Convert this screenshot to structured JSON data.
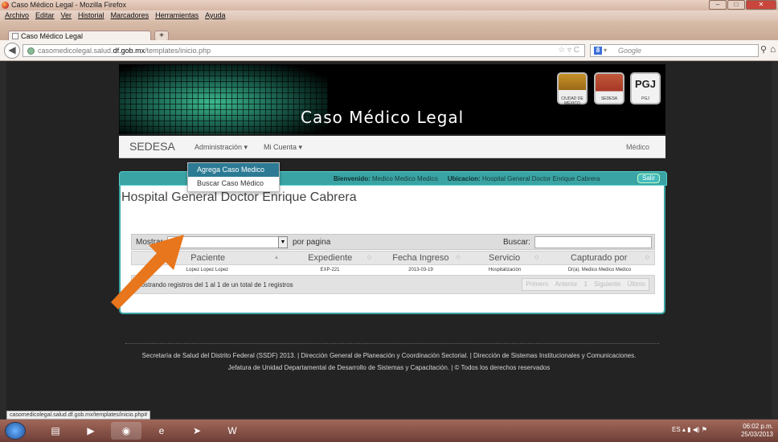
{
  "window": {
    "title": "Caso Médico Legal - Mozilla Firefox"
  },
  "menubar": [
    "Archivo",
    "Editar",
    "Ver",
    "Historial",
    "Marcadores",
    "Herramientas",
    "Ayuda"
  ],
  "tab": {
    "label": "Caso Médico Legal",
    "new_tab": "+"
  },
  "address": {
    "prefix": "casomedicolegal.salud.",
    "domain": "df.gob.mx",
    "path": "/templates/inicio.php",
    "icons": "☆ ▿ C"
  },
  "search_engine": {
    "placeholder": "Google",
    "badge": "8",
    "selector": "▾"
  },
  "banner": {
    "title": "Caso Médico Legal",
    "logos": [
      {
        "caption": "CIUDAD DE MÉXICO"
      },
      {
        "caption": "SEDESA"
      },
      {
        "text": "PGJ",
        "caption": "PGJ"
      }
    ]
  },
  "nav": {
    "brand": "SEDESA",
    "items": [
      "Administración ▾",
      "Mi Cuenta ▾"
    ],
    "right": "Médico"
  },
  "dropdown": {
    "items": [
      "Agrega Caso Medico",
      "Buscar Caso Médico"
    ],
    "active_index": 0
  },
  "welcome": {
    "bienvenido_label": "Bienvenido:",
    "bienvenido_value": "Medico Medico Medico",
    "ubicacion_label": "Ubicacion:",
    "ubicacion_value": "Hospital General Doctor Enrique Cabrera",
    "salir": "Salir"
  },
  "content": {
    "heading": "Hospital General Doctor Enrique Cabrera"
  },
  "table": {
    "mostrar_label": "Mostrar",
    "length_value": "10",
    "por_pagina": "por pagina",
    "buscar_label": "Buscar:",
    "columns": [
      "Paciente",
      "Expediente",
      "Fecha Ingreso",
      "Servicio",
      "Capturado por"
    ],
    "rows": [
      [
        "Lopez Lopez Lopez",
        "EXP-221",
        "2013-03-19",
        "Hospitalización",
        "Dr(a). Medico Medico Medico"
      ]
    ],
    "info": "Mostrando registros del 1 al 1 de un total de 1 registros",
    "pager": [
      "Primero",
      "Anterior",
      "1",
      "Siguiente",
      "Último"
    ]
  },
  "footer": {
    "line1": "Secretaría de Salud del Distrito Federal (SSDF) 2013.  |  Dirección General de Planeación y Coordinación Sectorial.  |  Dirección de Sistemas Institucionales y Comunicaciones.",
    "line2": "Jefatura de Unidad Departamental de Desarrollo de Sistemas y Capacitación.  |  © Todos los derechos reservados"
  },
  "statusbar": "casomedicolegal.salud.df.gob.mx/templates/inicio.php#",
  "taskbar": {
    "lang": "ES",
    "time": "06:02 p.m.",
    "date": "25/03/2013"
  },
  "colors": {
    "accent": "#3aa4a4",
    "dropdown_active": "#2c7a94",
    "arrow": "#e8761c"
  }
}
